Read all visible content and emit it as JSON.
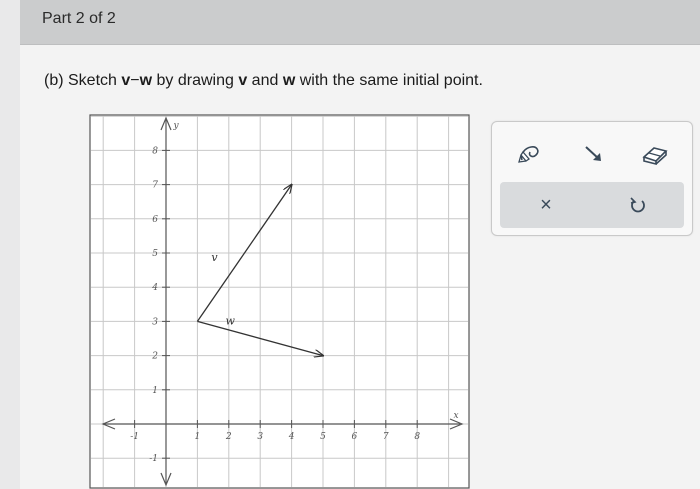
{
  "header": {
    "title": "Part 2 of 2"
  },
  "prompt": {
    "part": "(b) Sketch ",
    "v": "v",
    "minus": "−",
    "w": "w",
    "mid": " by drawing ",
    "v2": "v",
    "and": " and ",
    "w2": "w",
    "end": " with the same initial point."
  },
  "graph": {
    "x_axis_label": "x",
    "y_axis_label": "y",
    "x_ticks": [
      "-1",
      "1",
      "2",
      "3",
      "4",
      "5",
      "6",
      "7",
      "8"
    ],
    "y_ticks": [
      "-1",
      "1",
      "2",
      "3",
      "4",
      "5",
      "6",
      "7",
      "8"
    ],
    "vectors": [
      {
        "label": "v",
        "from": [
          1,
          3
        ],
        "to": [
          4,
          7
        ]
      },
      {
        "label": "w",
        "from": [
          1,
          3
        ],
        "to": [
          5,
          2
        ]
      }
    ]
  },
  "toolbox": {
    "tools": [
      "pencil-icon",
      "vector-arrow-icon",
      "eraser-icon"
    ],
    "actions": [
      "clear-x-icon",
      "undo-icon"
    ],
    "clear_symbol": "×"
  }
}
